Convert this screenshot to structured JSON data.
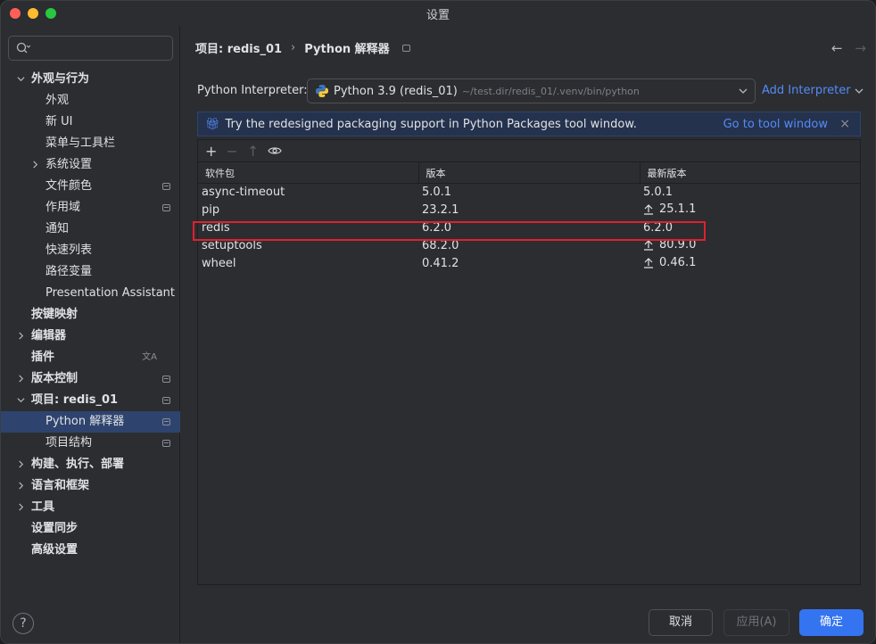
{
  "window": {
    "title": "设置"
  },
  "sidebar": {
    "search_placeholder": "",
    "items": [
      {
        "label": "外观与行为",
        "level": 0,
        "expanded": true,
        "bold": true
      },
      {
        "label": "外观",
        "level": 1
      },
      {
        "label": "新 UI",
        "level": 1
      },
      {
        "label": "菜单与工具栏",
        "level": 1
      },
      {
        "label": "系统设置",
        "level": 1,
        "collapsed": true
      },
      {
        "label": "文件颜色",
        "level": 1,
        "badge": true
      },
      {
        "label": "作用域",
        "level": 1,
        "badge": true
      },
      {
        "label": "通知",
        "level": 1
      },
      {
        "label": "快速列表",
        "level": 1
      },
      {
        "label": "路径变量",
        "level": 1
      },
      {
        "label": "Presentation Assistant",
        "level": 1
      },
      {
        "label": "按键映射",
        "level": 0,
        "bold": true
      },
      {
        "label": "编辑器",
        "level": 0,
        "collapsed": true,
        "bold": true
      },
      {
        "label": "插件",
        "level": 0,
        "bold": true,
        "translate_icon": true
      },
      {
        "label": "版本控制",
        "level": 0,
        "collapsed": true,
        "bold": true,
        "badge": true
      },
      {
        "label": "项目: redis_01",
        "level": 0,
        "expanded": true,
        "bold": true,
        "badge": true
      },
      {
        "label": "Python 解释器",
        "level": 1,
        "selected": true,
        "badge": true
      },
      {
        "label": "项目结构",
        "level": 1,
        "badge": true
      },
      {
        "label": "构建、执行、部署",
        "level": 0,
        "collapsed": true,
        "bold": true
      },
      {
        "label": "语言和框架",
        "level": 0,
        "collapsed": true,
        "bold": true
      },
      {
        "label": "工具",
        "level": 0,
        "collapsed": true,
        "bold": true
      },
      {
        "label": "设置同步",
        "level": 0,
        "bold": true
      },
      {
        "label": "高级设置",
        "level": 0,
        "bold": true
      }
    ],
    "help_label": "?"
  },
  "breadcrumb": {
    "project": "项目: redis_01",
    "separator": "›",
    "page": "Python 解释器"
  },
  "interpreter": {
    "label": "Python Interpreter:",
    "name": "Python 3.9 (redis_01)",
    "path": "~/test.dir/redis_01/.venv/bin/python",
    "add_label": "Add Interpreter"
  },
  "banner": {
    "message": "Try the redesigned packaging support in Python Packages tool window.",
    "link": "Go to tool window"
  },
  "packages": {
    "columns": [
      "软件包",
      "版本",
      "最新版本"
    ],
    "rows": [
      {
        "name": "async-timeout",
        "version": "5.0.1",
        "latest": "5.0.1",
        "upgrade": false
      },
      {
        "name": "pip",
        "version": "23.2.1",
        "latest": "25.1.1",
        "upgrade": true
      },
      {
        "name": "redis",
        "version": "6.2.0",
        "latest": "6.2.0",
        "upgrade": false,
        "highlighted": true
      },
      {
        "name": "setuptools",
        "version": "68.2.0",
        "latest": "80.9.0",
        "upgrade": true
      },
      {
        "name": "wheel",
        "version": "0.41.2",
        "latest": "0.46.1",
        "upgrade": true
      }
    ]
  },
  "footer": {
    "cancel": "取消",
    "apply": "应用(A)",
    "ok": "确定"
  },
  "colors": {
    "accent": "#3574f0",
    "link": "#548af7",
    "highlight": "#e0202e",
    "selection": "#2e436e"
  }
}
